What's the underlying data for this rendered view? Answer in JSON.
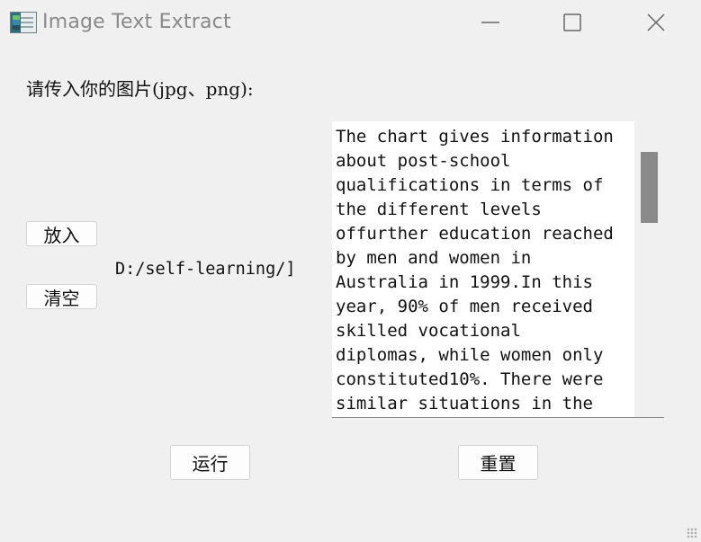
{
  "window": {
    "title": "Image Text Extract",
    "controls": {
      "minimize": "minimize-icon",
      "maximize": "maximize-icon",
      "close": "close-icon"
    }
  },
  "main": {
    "prompt_label": "请传入你的图片(jpg、png):",
    "put_button": "放入",
    "clear_button": "清空",
    "path_text": "D:/self-learning/]",
    "extracted_text": "The chart gives information\nabout post-school\nqualifications in terms of\nthe different levels\noffurther education reached\nby men and women in\nAustralia in 1999.In this\nyear, 90% of men received\nskilled vocational\ndiplomas, while women only\nconstituted10%. There were\nsimilar situations in the",
    "run_button": "运行",
    "reset_button": "重置"
  }
}
